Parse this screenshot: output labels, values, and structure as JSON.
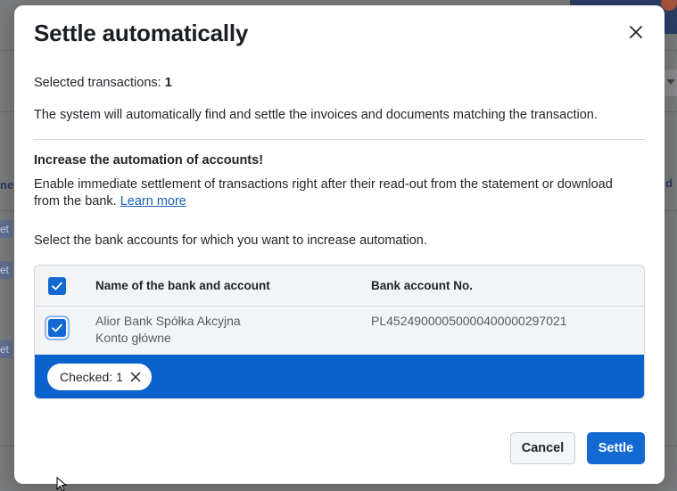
{
  "background": {
    "fragments": [
      "ne",
      "et",
      "et",
      "et",
      "d"
    ]
  },
  "modal": {
    "title": "Settle automatically",
    "selected_label": "Selected transactions:",
    "selected_count": "1",
    "description": "The system will automatically find and settle the invoices and documents matching the transaction.",
    "automation_title": "Increase the automation of accounts!",
    "automation_text": "Enable immediate settlement of transactions right after their read-out from the statement or download from the bank.",
    "learn_more": "Learn more",
    "select_prompt": "Select the bank accounts for which you want to increase automation.",
    "table": {
      "columns": [
        "Name of the bank and account",
        "Bank account No."
      ],
      "rows": [
        {
          "bank_name": "Alior Bank Spółka Akcyjna",
          "account_name": "Konto główne",
          "account_no": "PL45249000050000400000297021",
          "checked": true
        }
      ],
      "checked_chip": "Checked: 1"
    },
    "buttons": {
      "cancel": "Cancel",
      "settle": "Settle"
    }
  },
  "colors": {
    "accent": "#1368d1",
    "selection_bar": "#0a62cd",
    "overlay": "#7a7b7c"
  },
  "icons": {
    "close": "close-icon",
    "check": "check-icon",
    "chip_remove": "x-icon",
    "cursor": "mouse-pointer-icon"
  }
}
